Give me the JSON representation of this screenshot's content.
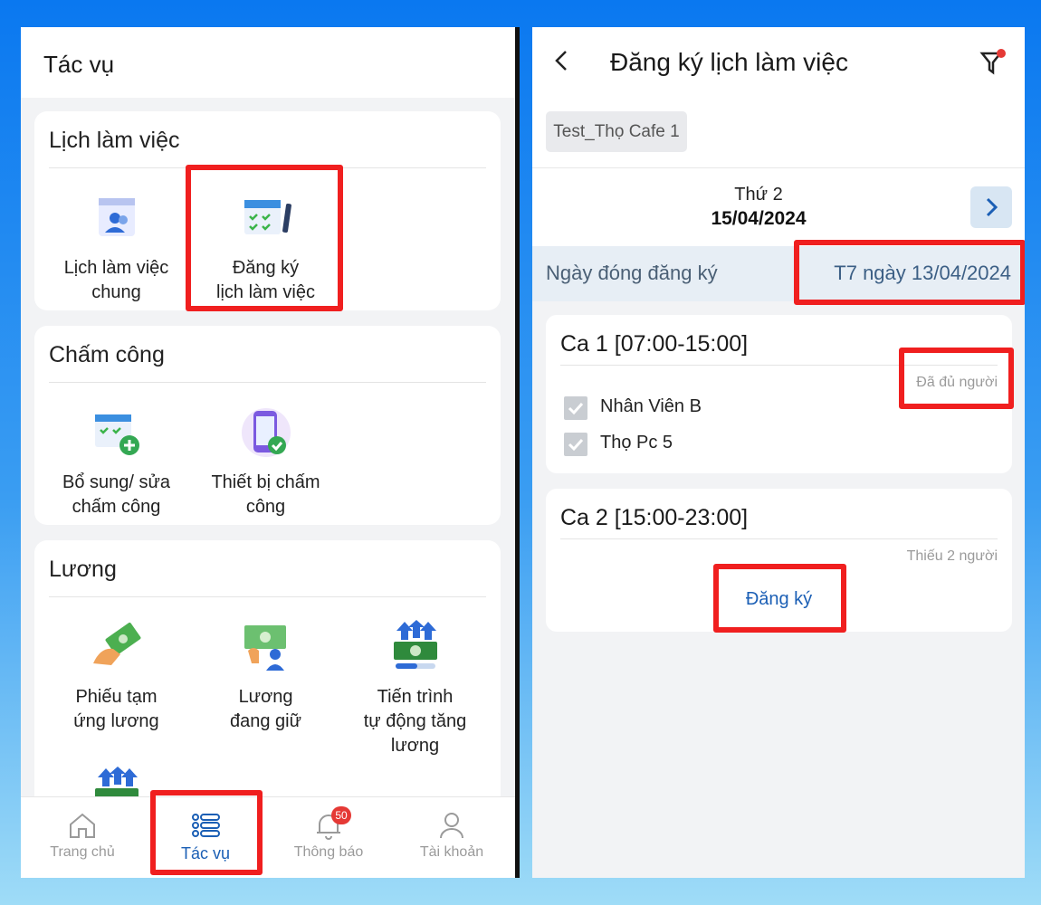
{
  "left": {
    "title": "Tác vụ",
    "sections": [
      {
        "title": "Lịch làm việc",
        "items": [
          {
            "line1": "Lịch làm việc",
            "line2": "chung"
          },
          {
            "line1": "Đăng ký",
            "line2": "lịch làm việc"
          }
        ]
      },
      {
        "title": "Chấm công",
        "items": [
          {
            "line1": "Bổ sung/ sửa",
            "line2": "chấm công"
          },
          {
            "line1": "Thiết bị chấm",
            "line2": "công"
          }
        ]
      },
      {
        "title": "Lương",
        "items": [
          {
            "line1": "Phiếu tạm",
            "line2": "ứng lương"
          },
          {
            "line1": "Lương",
            "line2": "đang giữ"
          },
          {
            "line1": "Tiến trình",
            "line2": "tự động tăng",
            "line3": "lương"
          }
        ]
      }
    ],
    "nav": [
      {
        "label": "Trang chủ"
      },
      {
        "label": "Tác vụ"
      },
      {
        "label": "Thông báo",
        "badge": "50"
      },
      {
        "label": "Tài khoản"
      }
    ]
  },
  "right": {
    "title": "Đăng ký lịch làm việc",
    "store_chip": "Test_Thọ Cafe 1",
    "day_name": "Thứ 2",
    "date": "15/04/2024",
    "close_label": "Ngày đóng đăng ký",
    "close_value": "T7 ngày 13/04/2024",
    "shifts": [
      {
        "title": "Ca 1 [07:00-15:00]",
        "status": "Đã đủ người",
        "members": [
          "Nhân Viên B",
          "Thọ Pc 5"
        ]
      },
      {
        "title": "Ca 2 [15:00-23:00]",
        "status": "Thiếu 2 người",
        "register_label": "Đăng ký"
      }
    ]
  },
  "colors": {
    "accent": "#1b5fb5",
    "highlight": "#f01f1f",
    "background": "#0a78f0"
  }
}
